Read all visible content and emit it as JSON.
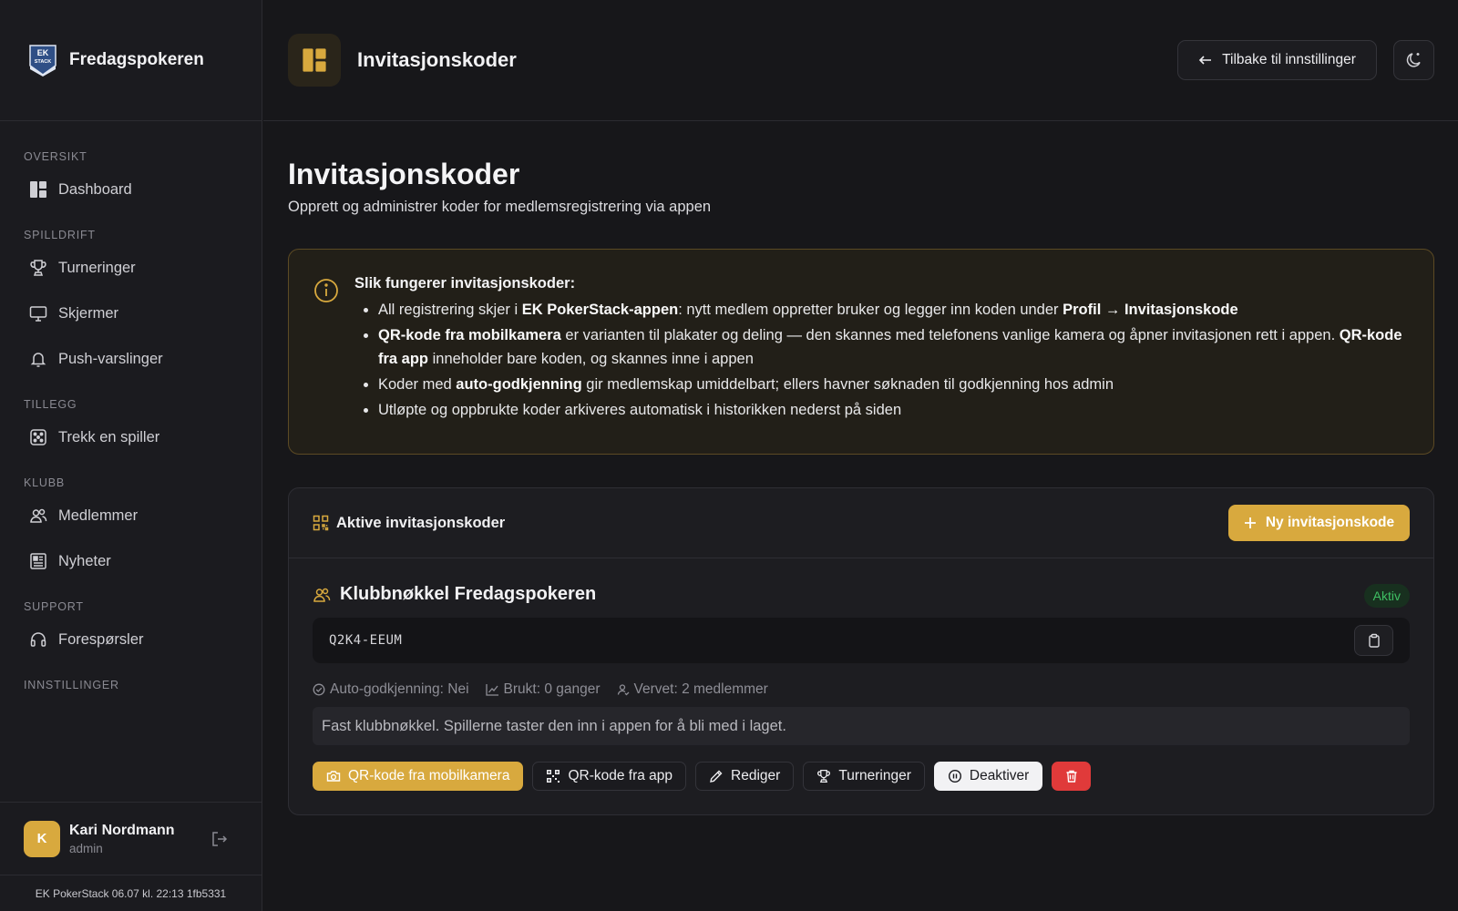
{
  "app": {
    "brand_name": "Fredagspokeren",
    "logo_text_top": "EK",
    "logo_text_bottom": "STACK"
  },
  "sidebar": {
    "sections": [
      {
        "heading": "OVERSIKT",
        "items": [
          {
            "label": "Dashboard",
            "icon": "dashboard-icon"
          }
        ]
      },
      {
        "heading": "SPILLDRIFT",
        "items": [
          {
            "label": "Turneringer",
            "icon": "trophy-icon"
          },
          {
            "label": "Skjermer",
            "icon": "monitor-icon"
          },
          {
            "label": "Push-varslinger",
            "icon": "bell-icon"
          }
        ]
      },
      {
        "heading": "TILLEGG",
        "items": [
          {
            "label": "Trekk en spiller",
            "icon": "dice-icon"
          }
        ]
      },
      {
        "heading": "KLUBB",
        "items": [
          {
            "label": "Medlemmer",
            "icon": "users-icon"
          },
          {
            "label": "Nyheter",
            "icon": "newspaper-icon"
          }
        ]
      },
      {
        "heading": "SUPPORT",
        "items": [
          {
            "label": "Forespørsler",
            "icon": "headset-icon"
          }
        ]
      },
      {
        "heading": "INNSTILLINGER",
        "items": []
      }
    ],
    "user": {
      "initial": "K",
      "name": "Kari Nordmann",
      "role": "admin"
    },
    "version": "EK PokerStack 06.07 kl. 22:13 1fb5331"
  },
  "header": {
    "title": "Invitasjonskoder",
    "back_label": "Tilbake til innstillinger"
  },
  "main": {
    "title": "Invitasjonskoder",
    "subtitle": "Opprett og administrer koder for medlemsregistrering via appen",
    "info": {
      "title": "Slik fungerer invitasjonskoder:",
      "items": [
        [
          {
            "t": "All registrering skjer i "
          },
          {
            "t": "EK PokerStack-appen",
            "b": true
          },
          {
            "t": ": nytt medlem oppretter bruker og legger inn koden under "
          },
          {
            "t": "Profil → Invitasjonskode",
            "b": true
          }
        ],
        [
          {
            "t": "QR-kode fra mobilkamera",
            "b": true
          },
          {
            "t": " er varianten til plakater og deling — den skannes med telefonens vanlige kamera og åpner invitasjonen rett i appen. "
          },
          {
            "t": "QR-kode fra app",
            "b": true
          },
          {
            "t": " inneholder bare koden, og skannes inne i appen"
          }
        ],
        [
          {
            "t": "Koder med "
          },
          {
            "t": "auto-godkjenning",
            "b": true
          },
          {
            "t": " gir medlemskap umiddelbart; ellers havner søknaden til godkjenning hos admin"
          }
        ],
        [
          {
            "t": "Utløpte og oppbrukte koder arkiveres automatisk i historikken nederst på siden"
          }
        ]
      ]
    },
    "card": {
      "title": "Aktive invitasjonskoder",
      "new_button": "Ny invitasjonskode",
      "entry": {
        "name": "Klubbnøkkel Fredagspokeren",
        "status": "Aktiv",
        "code": "Q2K4-EEUM",
        "auto_approval": "Auto-godkjenning: Nei",
        "used": "Brukt: 0 ganger",
        "recruited": "Vervet: 2 medlemmer",
        "description": "Fast klubbnøkkel. Spillerne taster den inn i appen for å bli med i laget.",
        "actions": {
          "qr_camera": "QR-kode fra mobilkamera",
          "qr_app": "QR-kode fra app",
          "edit": "Rediger",
          "tournaments": "Turneringer",
          "deactivate": "Deaktiver"
        }
      }
    }
  },
  "colors": {
    "accent": "#d8a93e",
    "background": "#17171a",
    "danger": "#e03a3a",
    "success": "#3fbf63"
  }
}
